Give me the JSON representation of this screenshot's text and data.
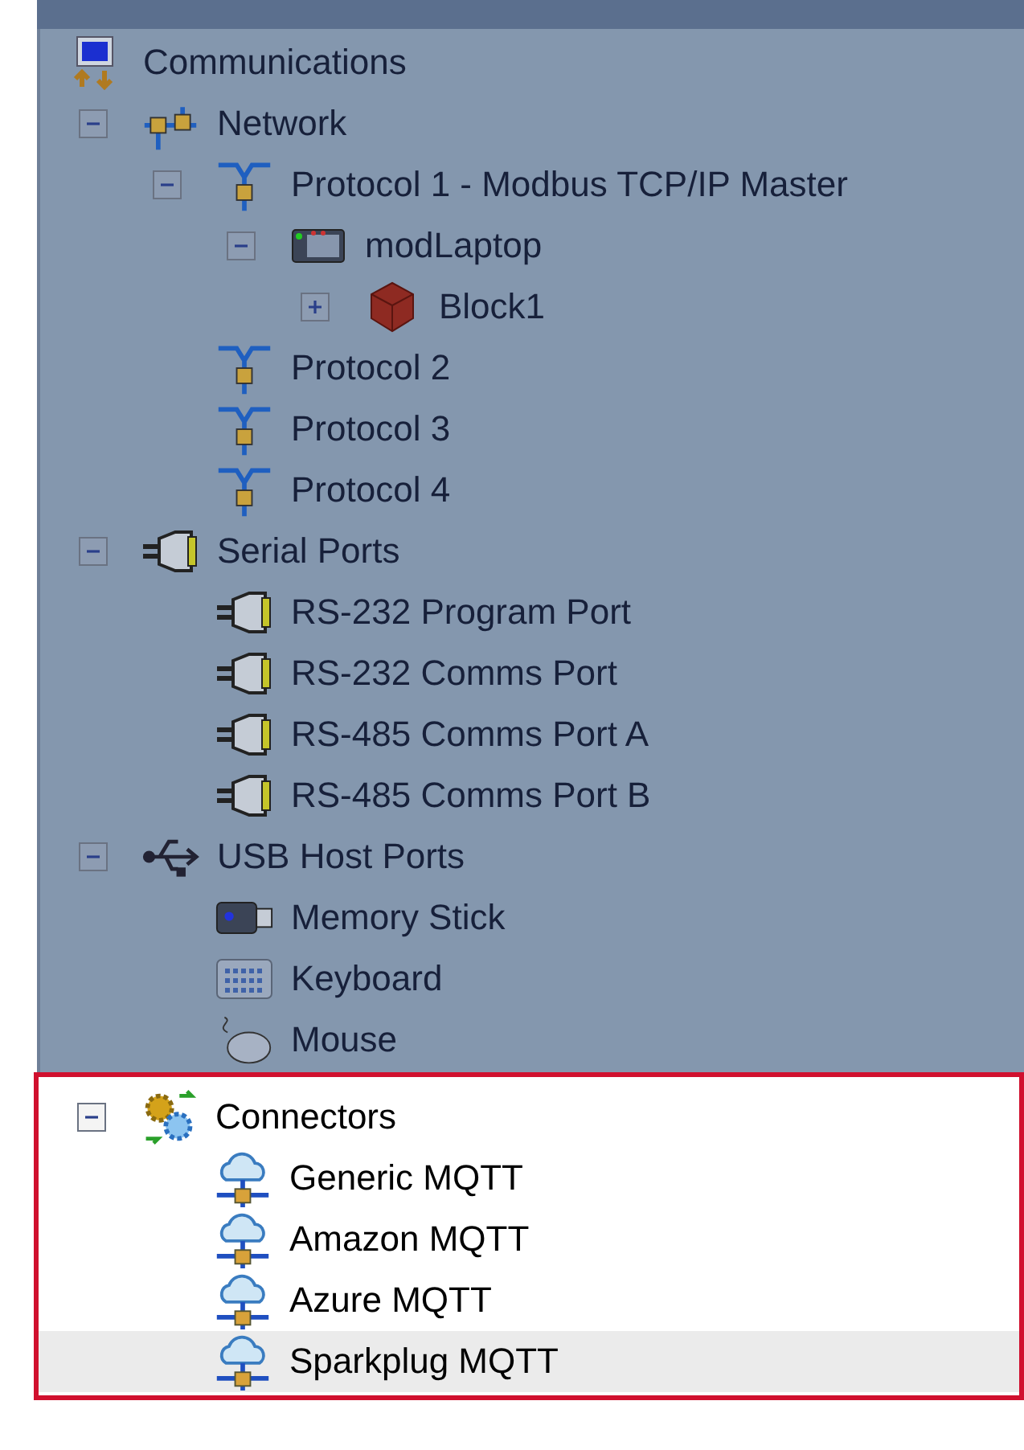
{
  "tree": [
    {
      "label": "Communications",
      "kind": "root",
      "selected": false,
      "children": [
        {
          "label": "Network",
          "kind": "network",
          "expanded": true,
          "highlighted": false,
          "selected": false,
          "children": [
            {
              "label": "Protocol 1 - Modbus TCP/IP Master",
              "kind": "protocol",
              "expanded": true,
              "selected": false,
              "children": [
                {
                  "label": "modLaptop",
                  "kind": "device",
                  "expanded": true,
                  "selected": false,
                  "children": [
                    {
                      "label": "Block1",
                      "kind": "block",
                      "expanded": false,
                      "selected": false
                    }
                  ]
                }
              ]
            },
            {
              "label": "Protocol 2",
              "kind": "protocol",
              "selected": false
            },
            {
              "label": "Protocol 3",
              "kind": "protocol",
              "selected": false
            },
            {
              "label": "Protocol 4",
              "kind": "protocol",
              "selected": false
            }
          ]
        },
        {
          "label": "Serial Ports",
          "kind": "serial",
          "expanded": true,
          "highlighted": false,
          "selected": false,
          "children": [
            {
              "label": "RS-232 Program Port",
              "kind": "serial",
              "selected": false
            },
            {
              "label": "RS-232 Comms Port",
              "kind": "serial",
              "selected": false
            },
            {
              "label": "RS-485 Comms Port A",
              "kind": "serial",
              "selected": false
            },
            {
              "label": "RS-485 Comms Port B",
              "kind": "serial",
              "selected": false
            }
          ]
        },
        {
          "label": "USB Host Ports",
          "kind": "usb",
          "expanded": true,
          "highlighted": false,
          "selected": false,
          "children": [
            {
              "label": "Memory Stick",
              "kind": "memory-stick",
              "selected": false
            },
            {
              "label": "Keyboard",
              "kind": "keyboard",
              "selected": false
            },
            {
              "label": "Mouse",
              "kind": "mouse",
              "selected": false
            }
          ]
        },
        {
          "label": "Connectors",
          "kind": "connectors",
          "expanded": true,
          "highlighted": true,
          "selected": false,
          "children": [
            {
              "label": "Generic MQTT",
              "kind": "cloud",
              "selected": false
            },
            {
              "label": "Amazon MQTT",
              "kind": "cloud",
              "selected": false
            },
            {
              "label": "Azure MQTT",
              "kind": "cloud",
              "selected": false
            },
            {
              "label": "Sparkplug MQTT",
              "kind": "cloud",
              "selected": true
            }
          ]
        }
      ]
    }
  ]
}
